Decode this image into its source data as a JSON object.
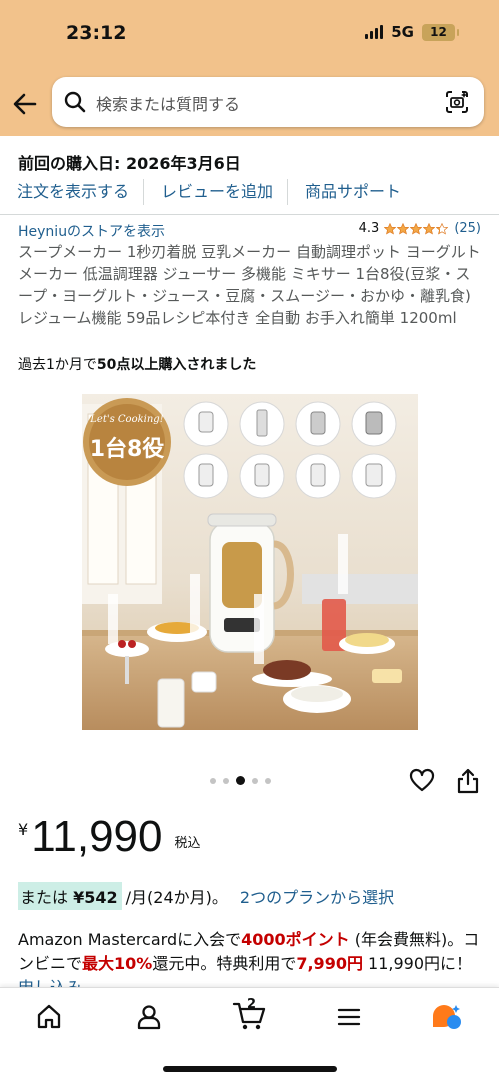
{
  "status": {
    "time": "23:12",
    "network": "5G",
    "battery": "12"
  },
  "search": {
    "placeholder": "検索または質問する"
  },
  "order": {
    "purchase_date": "前回の購入日: 2026年3月6日",
    "links": [
      "注文を表示する",
      "レビューを追加",
      "商品サポート"
    ]
  },
  "product": {
    "store_link": "Heyniuのストアを表示",
    "rating": "4.3",
    "rating_stars": 4.3,
    "review_count": "(25)",
    "title": "スープメーカー 1秒刃着脱 豆乳メーカー 自動調理ポット ヨーグルトメーカー 低温調理器 ジューサー 多機能 ミキサー 1台8役(豆浆・スープ・ヨーグルト・ジュース・豆腐・スムージー・おかゆ・離乳食) レジューム機能 59品レシピ本付き 全自動 お手入れ簡単 1200ml",
    "bought_prefix": "過去1か月で",
    "bought_bold": "50点以上購入されました",
    "image_badge_script": "Let's Cooking!",
    "image_badge": "1台8役",
    "carousel": {
      "count": 5,
      "active": 2
    }
  },
  "price": {
    "yen": "¥",
    "amount": "11,990",
    "tax": "税込"
  },
  "installment": {
    "prefix": "または",
    "amount": "¥542",
    "period": "/月(24か月)。",
    "link": "2つのプランから選択"
  },
  "promo": {
    "t1": "Amazon Mastercardに入会で",
    "r1": "4000ポイント",
    "t2": " (年会費無料)。コンビニで",
    "r2": "最大10%",
    "t3": "還元中。特典利用で",
    "r3": "7,990円",
    "t4": " 11,990円",
    "t5": "に！",
    "link": "申し込み"
  },
  "nav": {
    "cart_count": "2"
  },
  "colors": {
    "header": "#f2c28b",
    "link": "#1f5e8e",
    "deal": "#c40000",
    "highlight": "#cdeee6",
    "star": "#f3a847"
  }
}
